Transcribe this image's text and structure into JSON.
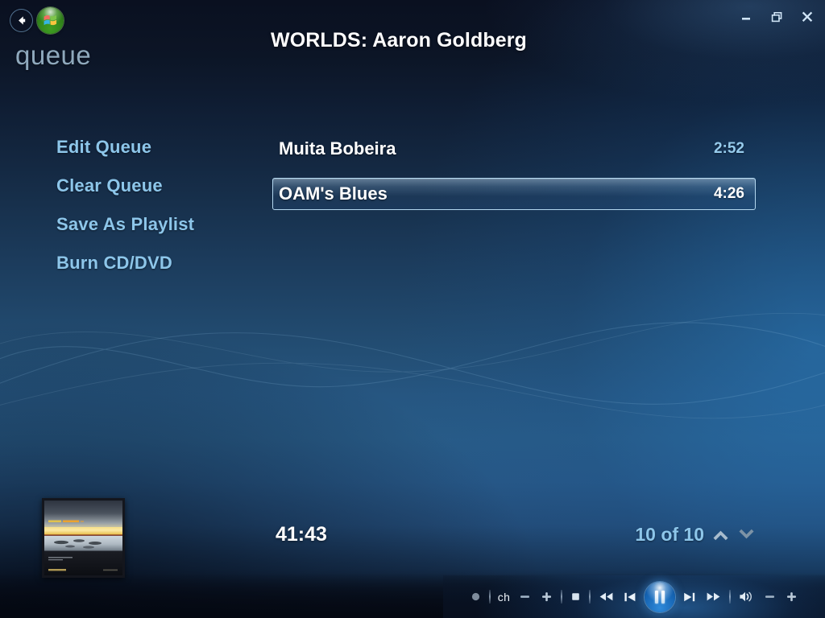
{
  "window": {
    "minimize_label": "Minimize",
    "restore_label": "Restore",
    "close_label": "Close"
  },
  "header": {
    "back_label": "Back",
    "start_label": "Start",
    "section": "queue",
    "title": "WORLDS: Aaron Goldberg"
  },
  "sidebar": {
    "items": [
      {
        "label": "Edit Queue"
      },
      {
        "label": "Clear Queue"
      },
      {
        "label": "Save As Playlist"
      },
      {
        "label": "Burn CD/DVD"
      }
    ]
  },
  "tracklist": {
    "tracks": [
      {
        "name": "Muita Bobeira",
        "duration": "2:52",
        "selected": false
      },
      {
        "name": "OAM's Blues",
        "duration": "4:26",
        "selected": true
      }
    ]
  },
  "now_playing": {
    "album_art_label": "Album art",
    "elapsed": "41:43",
    "counter": "10 of 10",
    "up_label": "Previous item",
    "down_label": "Next item"
  },
  "transport": {
    "record_label": "Record",
    "channel_label": "ch",
    "channel_down_label": "Channel down",
    "channel_up_label": "Channel up",
    "stop_label": "Stop",
    "rewind_label": "Rewind",
    "previous_label": "Previous track",
    "pause_label": "Pause",
    "next_label": "Next track",
    "forward_label": "Fast forward",
    "volume_label": "Mute",
    "volume_down_label": "Volume down",
    "volume_up_label": "Volume up"
  },
  "colors": {
    "accent_blue": "#8dc6ea",
    "title_white": "#fdfdfe",
    "duration_blue": "#96cbec",
    "section_grey": "#8fa9bd",
    "bg_top": "#0a1020",
    "bg_mid": "#265681"
  }
}
